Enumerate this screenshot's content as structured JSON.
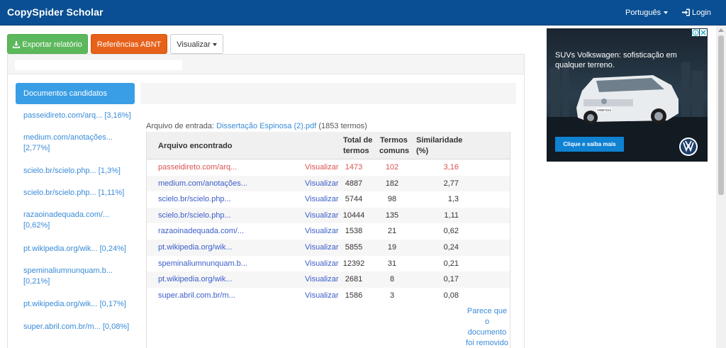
{
  "navbar": {
    "brand": "CopySpider Scholar",
    "language": "Português",
    "login": "Login"
  },
  "toolbar": {
    "export_label": "Exportar relatório",
    "abnt_label": "Referências ABNT",
    "view_label": "Visualizar"
  },
  "sidebar": {
    "active_label": "Documentos candidatos",
    "items": [
      {
        "line1": "passeidireto.com/arq... [3,16%]",
        "line2": ""
      },
      {
        "line1": "medium.com/anotações...",
        "line2": "[2,77%]"
      },
      {
        "line1": "scielo.br/scielo.php... [1,3%]",
        "line2": ""
      },
      {
        "line1": "scielo.br/scielo.php... [1,11%]",
        "line2": ""
      },
      {
        "line1": "razaoinadequada.com/...",
        "line2": "[0,62%]"
      },
      {
        "line1": "pt.wikipedia.org/wik... [0,24%]",
        "line2": ""
      },
      {
        "line1": "speminaliumnunquam.b...",
        "line2": "[0,21%]"
      },
      {
        "line1": "pt.wikipedia.org/wik... [0,17%]",
        "line2": ""
      },
      {
        "line1": "super.abril.com.br/m... [0,08%]",
        "line2": ""
      }
    ]
  },
  "report": {
    "input_label": "Arquivo de entrada:",
    "input_file": "Dissertação Espinosa (2).pdf",
    "input_terms": "(1853 termos)",
    "columns": {
      "found": "Arquivo encontrado",
      "total_1": "Total de",
      "total_2": "termos",
      "common_1": "Termos",
      "common_2": "comuns",
      "sim_1": "Similaridade",
      "sim_2": "(%)"
    },
    "rows": [
      {
        "name": "passeidireto.com/arq...",
        "view": "Visualizar",
        "total": "1473",
        "common": "102",
        "similarity": "3,16"
      },
      {
        "name": "medium.com/anotações...",
        "view": "Visualizar",
        "total": "4887",
        "common": "182",
        "similarity": "2,77"
      },
      {
        "name": "scielo.br/scielo.php...",
        "view": "Visualizar",
        "total": "5744",
        "common": "98",
        "similarity": "1,3"
      },
      {
        "name": "scielo.br/scielo.php...",
        "view": "Visualizar",
        "total": "10444",
        "common": "135",
        "similarity": "1,11"
      },
      {
        "name": "razaoinadequada.com/...",
        "view": "Visualizar",
        "total": "1538",
        "common": "21",
        "similarity": "0,62"
      },
      {
        "name": "pt.wikipedia.org/wik...",
        "view": "Visualizar",
        "total": "5855",
        "common": "19",
        "similarity": "0,24"
      },
      {
        "name": "speminaliumnunquam.b...",
        "view": "Visualizar",
        "total": "12392",
        "common": "31",
        "similarity": "0,21"
      },
      {
        "name": "pt.wikipedia.org/wik...",
        "view": "Visualizar",
        "total": "2681",
        "common": "8",
        "similarity": "0,17"
      },
      {
        "name": "super.abril.com.br/m...",
        "view": "Visualizar",
        "total": "1586",
        "common": "3",
        "similarity": "0,08"
      }
    ],
    "removed_note": [
      "Parece que",
      "o",
      "documento",
      "foi removido"
    ]
  },
  "ad": {
    "headline": "SUVs Volkswagen: sofisticação em qualquer terreno.",
    "cta": "Clique e saiba mais",
    "plate": "VWB7224"
  },
  "colors": {
    "navbar": "#0a4f93",
    "export": "#5cb85c",
    "abnt": "#e8611a",
    "sidebar_active": "#3a9ee6",
    "link": "#3a8bd8",
    "highlight": "#d9534f"
  }
}
